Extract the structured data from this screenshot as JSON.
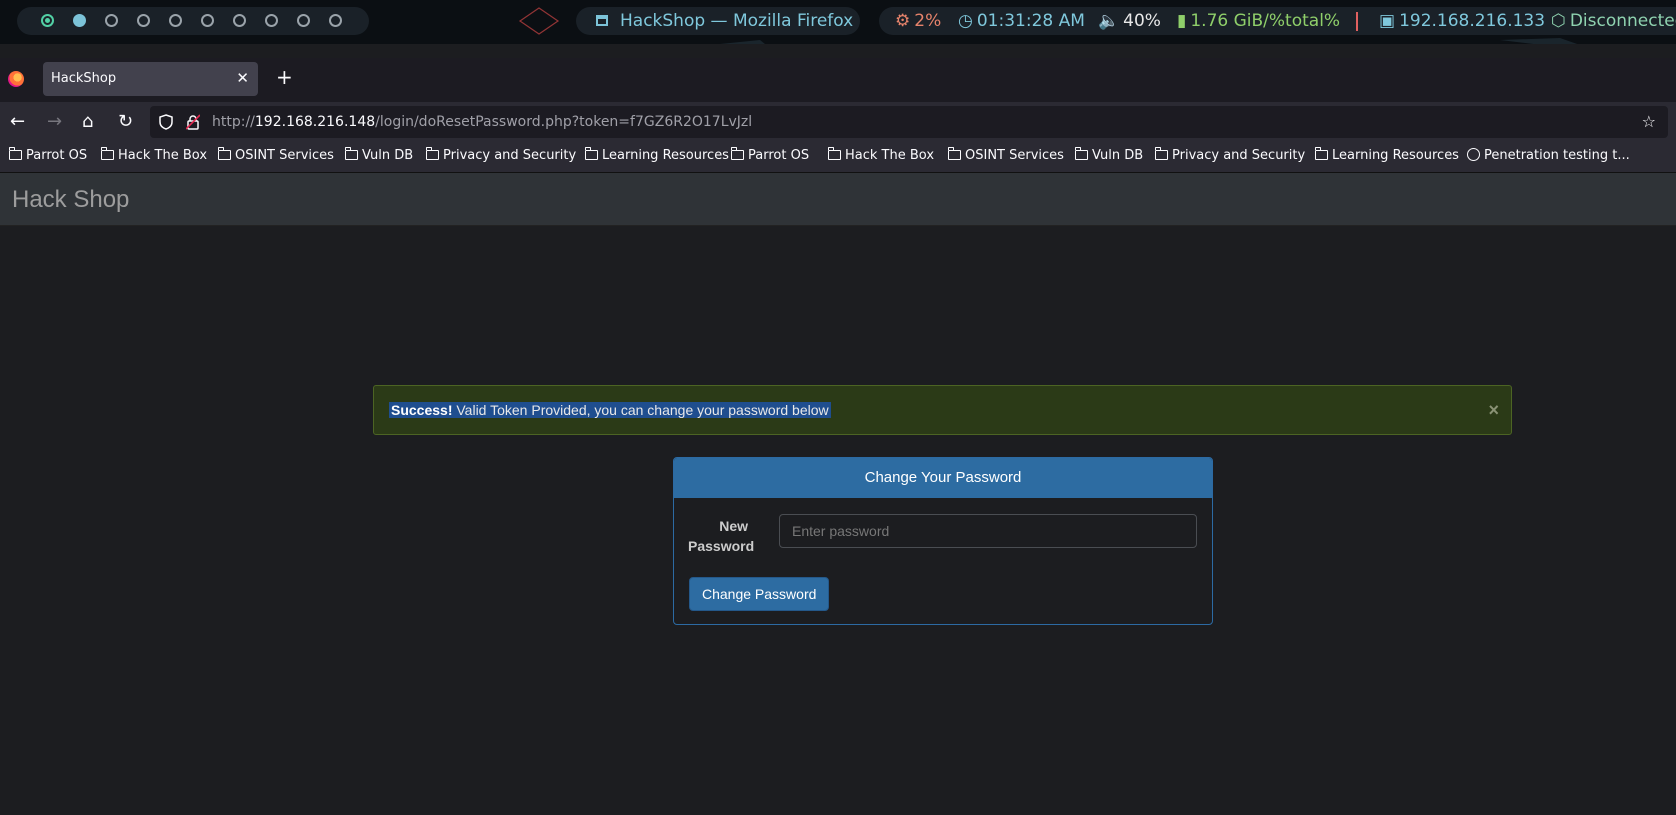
{
  "system_bar": {
    "window_title": "HackShop — Mozilla Firefox",
    "cpu": "2%",
    "clock": "01:31:28 AM",
    "volume": "40%",
    "memory": "1.76 GiB/%total%",
    "ip": "192.168.216.133",
    "vpn": "Disconnected",
    "colors": {
      "cpu": "#e6836b",
      "clock": "#7fc8dc",
      "volume": "#e8e8e8",
      "memory": "#8fcf6a",
      "ip": "#7fc8dc",
      "vpn": "#8fd3b0"
    }
  },
  "browser": {
    "tab_title": "HackShop",
    "url_prefix": "http://",
    "url_host": "192.168.216.148",
    "url_path": "/login/doResetPassword.php?token=f7GZ6R2O17LvJzl",
    "bookmarks": [
      {
        "label": "Parrot OS",
        "icon": "folder"
      },
      {
        "label": "Hack The Box",
        "icon": "folder"
      },
      {
        "label": "OSINT Services",
        "icon": "folder"
      },
      {
        "label": "Vuln DB",
        "icon": "folder"
      },
      {
        "label": "Privacy and Security",
        "icon": "folder"
      },
      {
        "label": "Learning Resources",
        "icon": "folder"
      },
      {
        "label": "Parrot OS",
        "icon": "folder"
      },
      {
        "label": "Hack The Box",
        "icon": "folder"
      },
      {
        "label": "OSINT Services",
        "icon": "folder"
      },
      {
        "label": "Vuln DB",
        "icon": "folder"
      },
      {
        "label": "Privacy and Security",
        "icon": "folder"
      },
      {
        "label": "Learning Resources",
        "icon": "folder"
      },
      {
        "label": "Penetration testing t...",
        "icon": "globe"
      }
    ]
  },
  "page": {
    "brand": "Hack Shop",
    "alert": {
      "strong": "Success!",
      "message": " Valid Token Provided, you can change your password below",
      "close": "×"
    },
    "panel": {
      "heading": "Change Your Password",
      "label": "New Password",
      "placeholder": "Enter password",
      "button": "Change Password"
    }
  }
}
